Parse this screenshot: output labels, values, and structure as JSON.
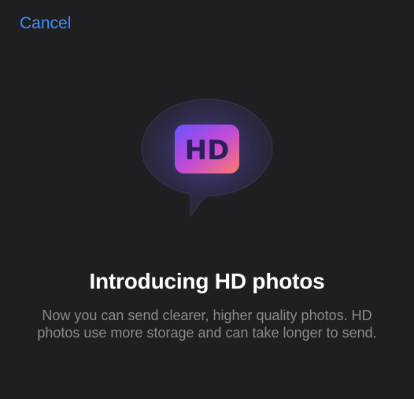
{
  "header": {
    "cancel_label": "Cancel"
  },
  "hero": {
    "icon": "hd-chat-bubble-icon",
    "badge_text": "HD",
    "colors": {
      "gradient_start": "#7a4dff",
      "gradient_mid": "#c04ad8",
      "gradient_end": "#ff7a6a",
      "badge_text": "#2a1f5a"
    }
  },
  "content": {
    "title": "Introducing HD photos",
    "description": "Now you can send clearer, higher quality photos. HD photos use more storage and can take longer to send."
  },
  "colors": {
    "background": "#1f1f21",
    "accent": "#3f8ff0",
    "secondary_text": "#8a8a8e"
  }
}
